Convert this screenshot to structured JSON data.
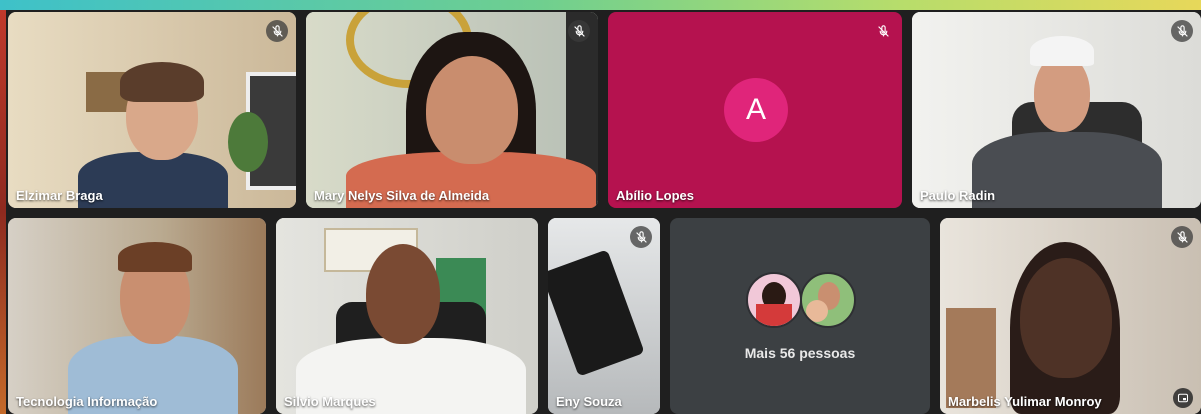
{
  "participants": [
    {
      "name": "Elzimar Braga",
      "muted": true
    },
    {
      "name": "Mary Nelys Silva de Almeida",
      "muted": true
    },
    {
      "name": "Abílio Lopes",
      "muted": true,
      "initial": "A"
    },
    {
      "name": "Paulo Radin",
      "muted": true
    },
    {
      "name": "Tecnologia Informação",
      "muted": false
    },
    {
      "name": "Silvio Marques",
      "muted": false
    },
    {
      "name": "Eny Souza",
      "muted": true
    },
    {
      "name": "Marbelis Yulimar Monroy",
      "muted": true
    }
  ],
  "more_people": {
    "label": "Mais 56 pessoas"
  },
  "colors": {
    "avatar_tile": "#b5124f",
    "avatar_circle": "#e0257a",
    "more_tile": "#3c4043"
  }
}
